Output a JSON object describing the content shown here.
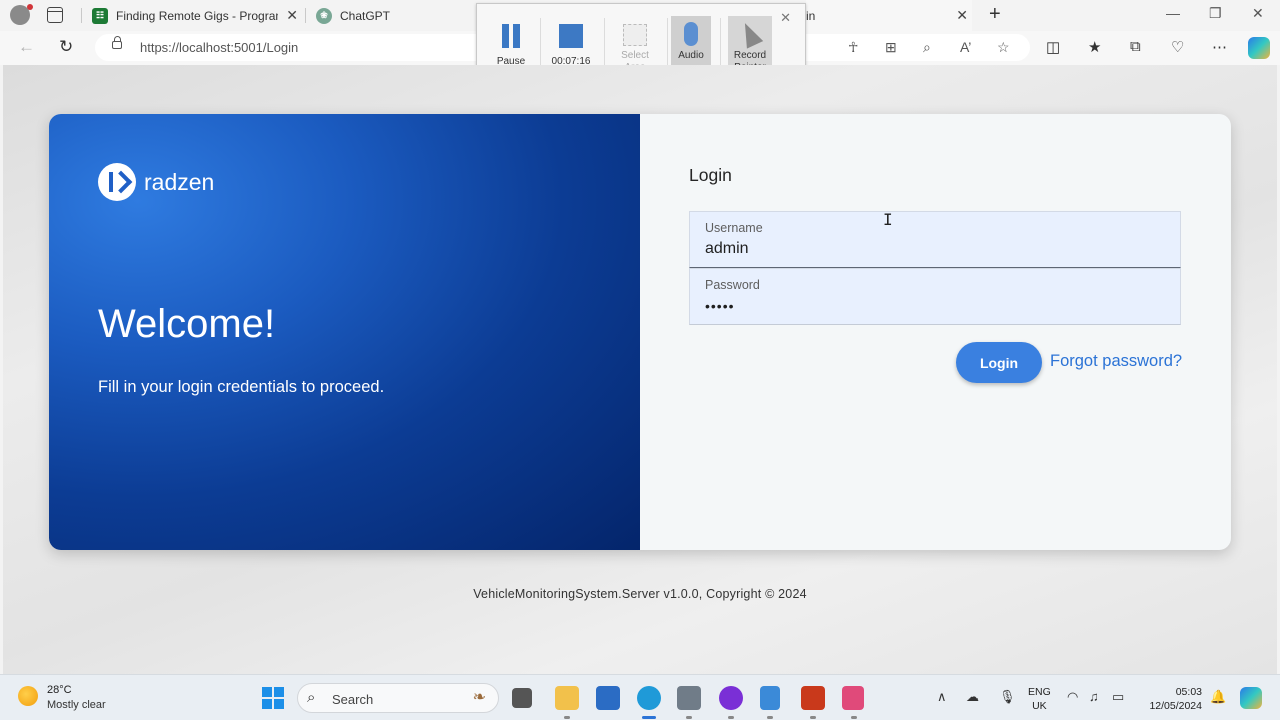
{
  "browser": {
    "tabs": [
      {
        "title": "Finding Remote Gigs - Programm"
      },
      {
        "title": "ChatGPT"
      },
      {
        "title": "in"
      }
    ],
    "url": "https://localhost:5001/Login"
  },
  "recorder": {
    "pause_label": "Pause",
    "timer": "00:07:16",
    "select_area_label": "Select\nArea",
    "audio_label": "Audio",
    "record_pointer_label": "Record\nPointer"
  },
  "hero": {
    "brand": "radzen",
    "welcome": "Welcome!",
    "subtitle": "Fill in your login credentials to proceed."
  },
  "login": {
    "title": "Login",
    "username_label": "Username",
    "username_value": "admin",
    "password_label": "Password",
    "password_value": "admin",
    "login_button": "Login",
    "forgot_link": "Forgot password?"
  },
  "footer": "VehicleMonitoringSystem.Server v1.0.0, Copyright © 2024",
  "taskbar": {
    "temperature": "28°C",
    "condition": "Mostly clear",
    "search_label": "Search",
    "lang_line1": "ENG",
    "lang_line2": "UK",
    "time": "05:03",
    "date": "12/05/2024"
  },
  "colors": {
    "accent": "#3a80e0",
    "hero_dark": "#04256b",
    "link": "#2b73d6"
  }
}
